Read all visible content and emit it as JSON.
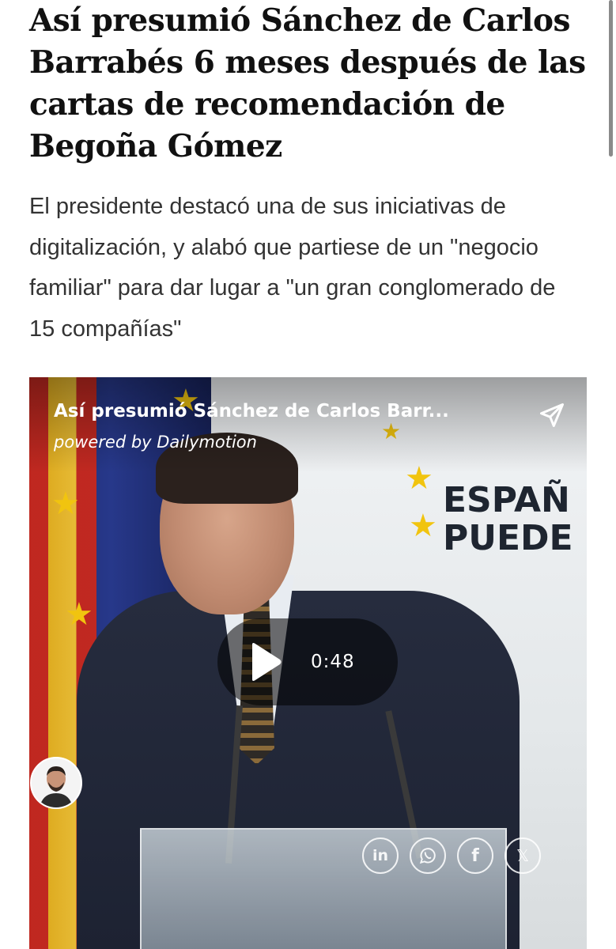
{
  "article": {
    "headline": "Así presumió Sánchez de Carlos Barrabés 6 meses después de las cartas de recomendación de Begoña Gómez",
    "subtitle": "El presidente destacó una de sus iniciativas de digitalización, y alabó que partiese de un \"negocio familiar\" para dar lugar a \"un gran conglomerado de 15 compañías\""
  },
  "video": {
    "title": "Así presumió Sánchez de Carlos Barr...",
    "powered_by": "powered by Dailymotion",
    "duration": "0:48",
    "background_text_line1": "ESPAÑ",
    "background_text_line2": "PUEDE",
    "share_icon": "send-icon",
    "play_icon": "play-icon"
  },
  "social": [
    {
      "name": "linkedin",
      "label": "in"
    },
    {
      "name": "whatsapp",
      "label": ""
    },
    {
      "name": "facebook",
      "label": "f"
    },
    {
      "name": "x",
      "label": "𝕏"
    }
  ],
  "colors": {
    "headline": "#111111",
    "subtitle": "#333333",
    "overlay_text": "#ffffff"
  }
}
